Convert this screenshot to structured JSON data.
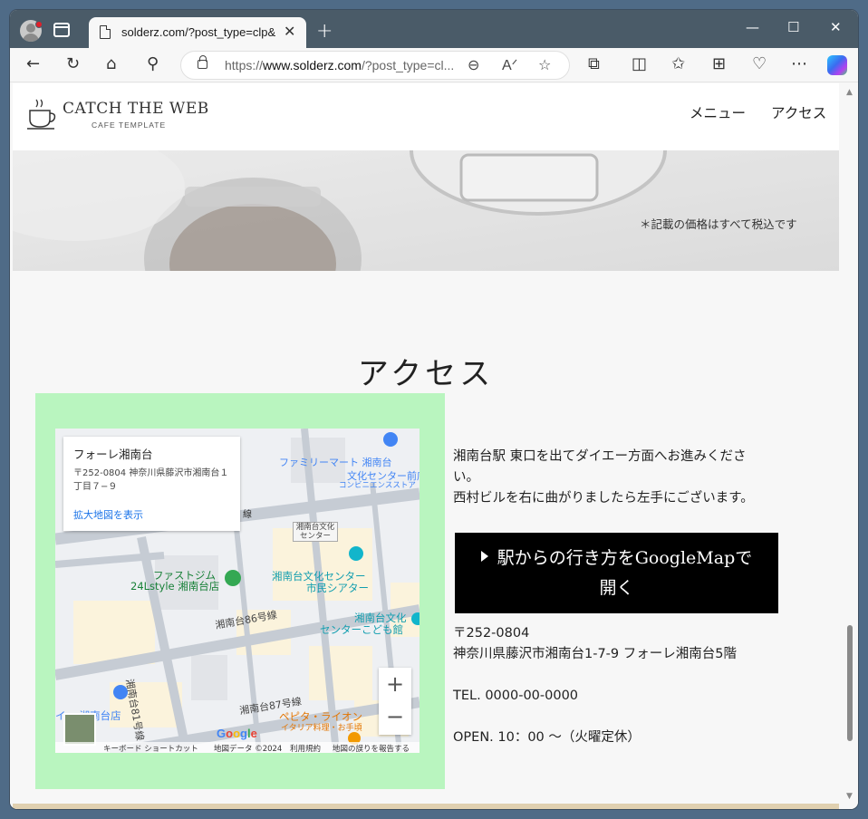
{
  "browser": {
    "tab_title": "solderz.com/?post_type=clp&p=",
    "tab_close": "✕",
    "new_tab": "+",
    "url_prefix": "https://",
    "url_domain": "www.solderz.com",
    "url_rest": "/?post_type=cl...",
    "window_controls": {
      "minimize": "—",
      "maximize": "☐",
      "close": "✕"
    }
  },
  "site": {
    "logo_name": "CATCH THE WEB",
    "logo_sub": "CAFE TEMPLATE",
    "nav": [
      "メニュー",
      "アクセス"
    ]
  },
  "hero": {
    "note": "＊記載の価格はすべて税込です"
  },
  "access": {
    "title": "アクセス",
    "directions_line1": "湘南台駅 東口を出てダイエー方面へお進みくださ",
    "directions_line2": "い。",
    "directions_line3": "西村ビルを右に曲がりましたら左手にございます。",
    "button_line1": "駅からの行き方をGoogleMapで",
    "button_line2": "開く",
    "postal": "〒252-0804",
    "address": "神奈川県藤沢市湘南台1-7-9 フォーレ湘南台5階",
    "tel": "TEL. 0000-00-0000",
    "hours": "OPEN. 10：00 〜（火曜定休）"
  },
  "map": {
    "card_title": "フォーレ湘南台",
    "card_address": "〒252-0804 神奈川県藤沢市湘南台１丁目７−９",
    "card_link": "拡大地図を表示",
    "zoom_in": "+",
    "zoom_out": "−",
    "google": "Google",
    "footer": [
      "キーボード ショートカット",
      "地図データ ©2024",
      "利用規約",
      "地図の誤りを報告する"
    ],
    "labels": {
      "familymart": "ファミリーマート 湘南台",
      "familymart2": "文化センター前店",
      "convenience": "コンビニエンスストア",
      "gym1": "ファストジム",
      "gym2": "24Lstyle 湘南台店",
      "culture1": "湘南台文化センター",
      "culture2": "市民シアター",
      "culture_small1": "湘南台文化",
      "culture_small2": "センター",
      "kids1": "湘南台文化",
      "kids2": "センターこども館",
      "road86": "湘南台86号線",
      "road87": "湘南台87号線",
      "road81": "湘南台81号線",
      "road_top": "線",
      "store": "イー 湘南台店",
      "pepita": "ペピタ・ライオン",
      "pepita2": "イタリア料理・お手頃"
    }
  },
  "colors": {
    "map_border": "#b9f5bf",
    "button_bg": "#000000",
    "footer_bar": "#e0d0b0"
  }
}
